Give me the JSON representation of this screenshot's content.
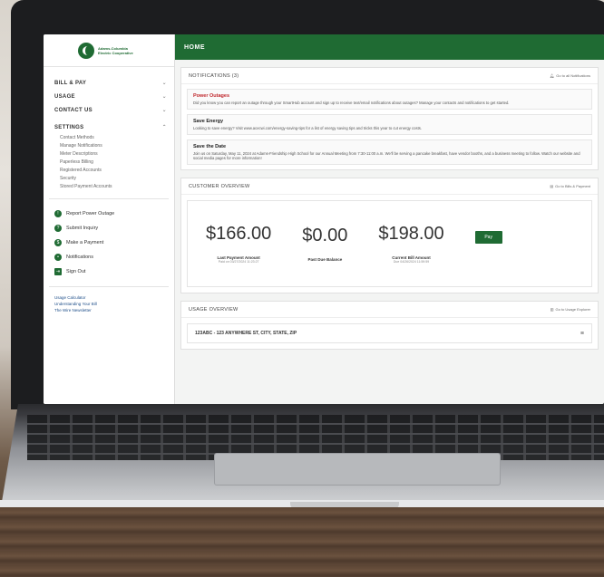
{
  "app": {
    "header_title": "HOME",
    "logo_text": "Adams-Columbia Electric Cooperative"
  },
  "sidebar": {
    "menu": [
      {
        "label": "BILL & PAY",
        "chev": "⌄"
      },
      {
        "label": "USAGE",
        "chev": "⌄"
      },
      {
        "label": "CONTACT US",
        "chev": "⌄"
      },
      {
        "label": "SETTINGS",
        "chev": "⌃"
      }
    ],
    "settings_items": [
      "Contact Methods",
      "Manage Notifications",
      "Meter Descriptions",
      "Paperless Billing",
      "Registered Accounts",
      "Security",
      "Stored Payment Accounts"
    ],
    "actions": [
      {
        "label": "Report Power Outage",
        "icon": "!"
      },
      {
        "label": "Submit Inquiry",
        "icon": "?"
      },
      {
        "label": "Make a Payment",
        "icon": "$"
      },
      {
        "label": "Notifications",
        "icon": "•"
      },
      {
        "label": "Sign Out",
        "icon": "⇥"
      }
    ],
    "links": [
      "Usage Calculator",
      "Understanding Your Bill",
      "The Wire Newsletter"
    ]
  },
  "notifications": {
    "header": "NOTIFICATIONS (3)",
    "aux_label": "Go to all Notifications",
    "items": [
      {
        "title": "Power Outages",
        "body": "Did you know you can report an outage through your SmartHub account and sign up to receive text/email notifications about outages? Manage your contacts and notifications to get started."
      },
      {
        "title": "Save Energy",
        "body": "Looking to save energy? Visit www.acecwi.com/energy-saving-tips for a list of energy saving tips and tricks this year to cut energy costs."
      },
      {
        "title": "Save the Date",
        "body": "Join us on Saturday, May 11, 2024 at Adams-Friendship High School for our Annual Meeting from 7:30-11:00 a.m. We'll be serving a pancake breakfast, have vendor booths, and a business meeting to follow. Watch our website and social media pages for more information!"
      }
    ]
  },
  "overview": {
    "header": "CUSTOMER OVERVIEW",
    "aux_label": "Go to Bills & Payment",
    "amounts": [
      {
        "value": "$166.00",
        "label": "Last Payment Amount",
        "sub": "Paid on 03/27/2024 11:23:27"
      },
      {
        "value": "$0.00",
        "label": "Past Due Balance",
        "sub": ""
      },
      {
        "value": "$198.00",
        "label": "Current Bill Amount",
        "sub": "Due 04/26/2024 11:59:59"
      }
    ],
    "pay_label": "Pay"
  },
  "usage": {
    "header": "USAGE OVERVIEW",
    "aux_label": "Go to Usage Explorer",
    "row_label": "123ABC - 123 ANYWHERE ST, CITY, STATE, ZIP"
  }
}
